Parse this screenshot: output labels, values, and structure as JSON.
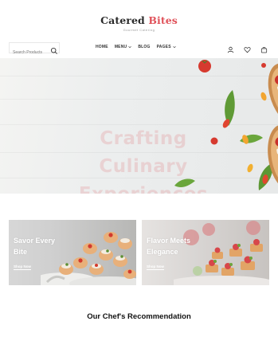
{
  "brand": {
    "name_part1": "Catered",
    "name_part2": "Bites",
    "tagline": "Gourmet Catering",
    "accent": "#e0525a"
  },
  "search": {
    "placeholder": "Search Products"
  },
  "nav": {
    "items": [
      {
        "label": "HOME"
      },
      {
        "label": "MENU"
      },
      {
        "label": "BLOG"
      },
      {
        "label": "PAGES"
      }
    ]
  },
  "header_icons": [
    "user-icon",
    "heart-icon",
    "cart-icon"
  ],
  "hero": {
    "title": "Crafting Culinary Experiences"
  },
  "promos": [
    {
      "title": "Savor Every Bite",
      "link": "Shop Now"
    },
    {
      "title": "Flavor Meets Elegance",
      "link": "Shop Now"
    }
  ],
  "recommendation": {
    "title": "Our Chef's Recommendation"
  }
}
